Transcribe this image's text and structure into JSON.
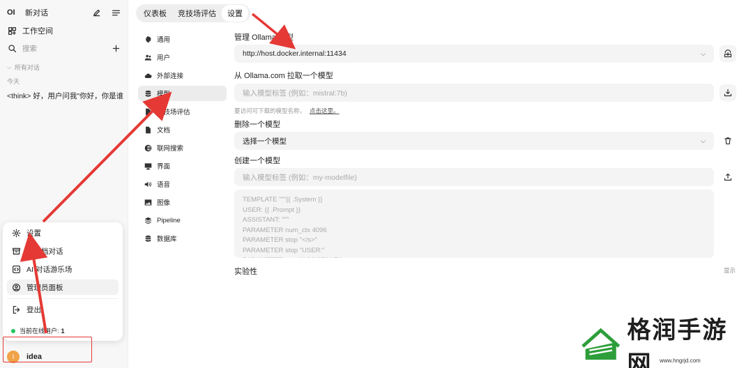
{
  "sidebar": {
    "logo": "OI",
    "new_chat": "新对话",
    "workspace": "工作空间",
    "search_placeholder": "搜索",
    "section_all": "所有对话",
    "section_today": "今天",
    "chat_item": "<think> 好，用户问我\"你好，你是谁"
  },
  "popup": {
    "settings": "设置",
    "archived": "已归档对话",
    "playground": "AI 对话游乐场",
    "admin_panel": "管理员面板",
    "logout": "登出",
    "online_label": "当前在线用户:",
    "online_count": "1"
  },
  "user": {
    "initial": "I",
    "name": "idea"
  },
  "tabs": [
    "仪表板",
    "竞技场评估",
    "设置"
  ],
  "settings_nav": [
    "通用",
    "用户",
    "外部连接",
    "模型",
    "竞技场评估",
    "文档",
    "联网搜索",
    "界面",
    "语音",
    "图像",
    "Pipeline",
    "数据库"
  ],
  "main": {
    "manage_title": "管理 Ollama 模型",
    "ollama_url": "http://host.docker.internal:11434",
    "pull_title": "从 Ollama.com 拉取一个模型",
    "pull_placeholder": "输入模型标签 (例如：mistral:7b)",
    "hint_text": "要访问可下载的模型名称，",
    "hint_link": "点击这里。",
    "delete_title": "删除一个模型",
    "delete_select": "选择一个模型",
    "create_title": "创建一个模型",
    "create_placeholder": "输入模型标签 (例如：my-modelfile)",
    "modelfile": "TEMPLATE \"\"\"{{ .System }}\nUSER: {{ .Prompt }}\nASSISTANT: \"\"\"\nPARAMETER num_ctx 4096\nPARAMETER stop \"</s>\"\nPARAMETER stop \"USER:\"\nPARAMETER stop \"ASSISTANT:\"",
    "experimental": "实验性",
    "show": "显示"
  },
  "watermark": {
    "text": "格润手游网",
    "url": "www.hngrjd.com"
  },
  "colors": {
    "arrow": "#e53935",
    "online": "#22c55e",
    "avatar": "#f0a349",
    "watermark_green": "#2e9e3a"
  }
}
